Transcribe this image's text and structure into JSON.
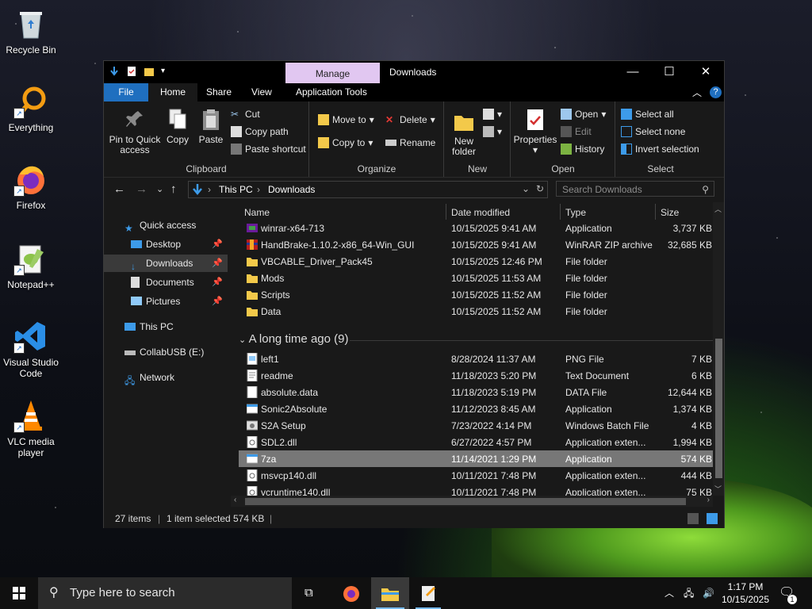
{
  "desktop": {
    "icons": [
      {
        "label": "Recycle Bin",
        "icon": "recycle-bin-icon"
      },
      {
        "label": "Everything",
        "icon": "everything-search-icon"
      },
      {
        "label": "Firefox",
        "icon": "firefox-icon"
      },
      {
        "label": "Notepad++",
        "icon": "notepad-plus-plus-icon"
      },
      {
        "label": "Visual Studio Code",
        "icon": "vscode-icon"
      },
      {
        "label": "VLC media player",
        "icon": "vlc-icon"
      }
    ]
  },
  "window": {
    "title": "Downloads",
    "context_tab": "Manage",
    "tabs": {
      "file": "File",
      "home": "Home",
      "share": "Share",
      "view": "View",
      "app_tools": "Application Tools"
    },
    "controls": {
      "minimize": "—",
      "maximize": "☐",
      "close": "✕",
      "help": "?"
    }
  },
  "ribbon": {
    "clipboard": {
      "label": "Clipboard",
      "pin": "Pin to Quick access",
      "copy": "Copy",
      "paste": "Paste",
      "cut": "Cut",
      "copy_path": "Copy path",
      "paste_shortcut": "Paste shortcut"
    },
    "organize": {
      "label": "Organize",
      "move_to": "Move to",
      "copy_to": "Copy to",
      "delete": "Delete",
      "rename": "Rename"
    },
    "new": {
      "label": "New",
      "new_folder": "New folder"
    },
    "open": {
      "label": "Open",
      "properties": "Properties",
      "open": "Open",
      "edit": "Edit",
      "history": "History"
    },
    "select": {
      "label": "Select",
      "select_all": "Select all",
      "select_none": "Select none",
      "invert": "Invert selection"
    }
  },
  "address": {
    "crumbs": [
      "This PC",
      "Downloads"
    ],
    "search_placeholder": "Search Downloads"
  },
  "nav": {
    "items": [
      {
        "label": "Quick access",
        "pinned": false
      },
      {
        "label": "Desktop",
        "pinned": true
      },
      {
        "label": "Downloads",
        "pinned": true
      },
      {
        "label": "Documents",
        "pinned": true
      },
      {
        "label": "Pictures",
        "pinned": true
      },
      {
        "label": "This PC",
        "pinned": false
      },
      {
        "label": "CollabUSB (E:)",
        "pinned": false
      },
      {
        "label": "Network",
        "pinned": false
      }
    ]
  },
  "columns": {
    "name": "Name",
    "date": "Date modified",
    "type": "Type",
    "size": "Size"
  },
  "files_recent": [
    {
      "name": "winrar-x64-713",
      "date": "10/15/2025 9:41 AM",
      "type": "Application",
      "size": "3,737 KB",
      "icon": "winrar-installer-icon"
    },
    {
      "name": "HandBrake-1.10.2-x86_64-Win_GUI",
      "date": "10/15/2025 9:41 AM",
      "type": "WinRAR ZIP archive",
      "size": "32,685 KB",
      "icon": "zip-archive-icon"
    },
    {
      "name": "VBCABLE_Driver_Pack45",
      "date": "10/15/2025 12:46 PM",
      "type": "File folder",
      "size": "",
      "icon": "folder-icon"
    },
    {
      "name": "Mods",
      "date": "10/15/2025 11:53 AM",
      "type": "File folder",
      "size": "",
      "icon": "folder-icon"
    },
    {
      "name": "Scripts",
      "date": "10/15/2025 11:52 AM",
      "type": "File folder",
      "size": "",
      "icon": "folder-icon"
    },
    {
      "name": "Data",
      "date": "10/15/2025 11:52 AM",
      "type": "File folder",
      "size": "",
      "icon": "folder-icon"
    }
  ],
  "group_old": "A long time ago (9)",
  "files_old": [
    {
      "name": "left1",
      "date": "8/28/2024 11:37 AM",
      "type": "PNG File",
      "size": "7 KB",
      "icon": "image-file-icon"
    },
    {
      "name": "readme",
      "date": "11/18/2023 5:20 PM",
      "type": "Text Document",
      "size": "6 KB",
      "icon": "text-file-icon"
    },
    {
      "name": "absolute.data",
      "date": "11/18/2023 5:19 PM",
      "type": "DATA File",
      "size": "12,644 KB",
      "icon": "generic-file-icon"
    },
    {
      "name": "Sonic2Absolute",
      "date": "11/12/2023 8:45 AM",
      "type": "Application",
      "size": "1,374 KB",
      "icon": "application-icon"
    },
    {
      "name": "S2A Setup",
      "date": "7/23/2022 4:14 PM",
      "type": "Windows Batch File",
      "size": "4 KB",
      "icon": "batch-file-icon"
    },
    {
      "name": "SDL2.dll",
      "date": "6/27/2022 4:57 PM",
      "type": "Application exten...",
      "size": "1,994 KB",
      "icon": "dll-file-icon"
    },
    {
      "name": "7za",
      "date": "11/14/2021 1:29 PM",
      "type": "Application",
      "size": "574 KB",
      "icon": "application-icon",
      "selected": true
    },
    {
      "name": "msvcp140.dll",
      "date": "10/11/2021 7:48 PM",
      "type": "Application exten...",
      "size": "444 KB",
      "icon": "dll-file-icon"
    },
    {
      "name": "vcruntime140.dll",
      "date": "10/11/2021 7:48 PM",
      "type": "Application exten...",
      "size": "75 KB",
      "icon": "dll-file-icon"
    }
  ],
  "status": {
    "count": "27 items",
    "selected": "1 item selected",
    "size": "574 KB",
    "sep": "|"
  },
  "taskbar": {
    "search_placeholder": "Type here to search",
    "time": "1:17 PM",
    "date": "10/15/2025",
    "notification_count": "1"
  },
  "colors": {
    "accent": "#1f6fbf",
    "manage_tab": "#e1c7f1",
    "folder": "#f3c94a",
    "selection": "#777777"
  }
}
